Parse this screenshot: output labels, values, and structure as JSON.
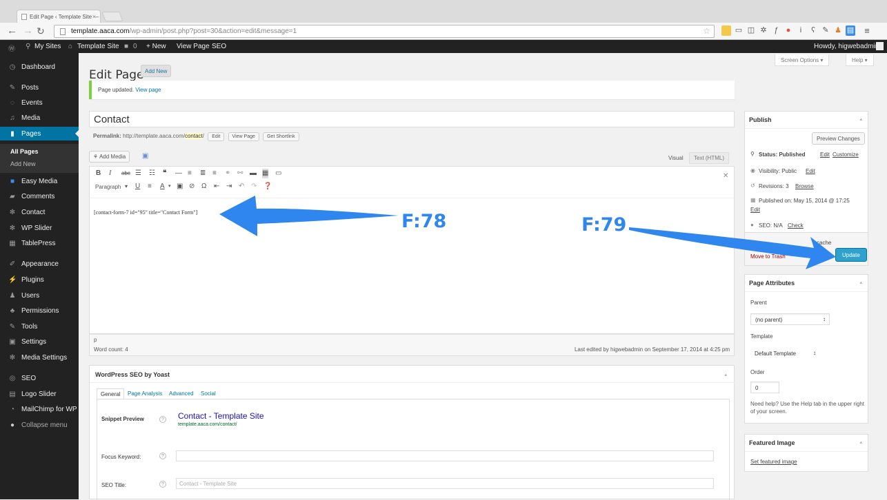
{
  "browser": {
    "tab_title": "Edit Page ‹ Template Site —",
    "tab_close": "×",
    "url_host": "template.aaca.com",
    "url_path": "/wp-admin/post.php?post=30&action=edit&message=1"
  },
  "adminbar": {
    "my_sites": "My Sites",
    "site_name": "Template Site",
    "comments_count": "0",
    "new_label": "+ New",
    "view_page": "View Page",
    "seo": "SEO",
    "howdy": "Howdy, higwebadmin"
  },
  "sidebar": {
    "items": [
      {
        "label": "Dashboard",
        "icon": "dashboard-icon"
      },
      {
        "label": "Posts",
        "icon": "pin-icon"
      },
      {
        "label": "Events",
        "icon": "events-icon"
      },
      {
        "label": "Media",
        "icon": "media-icon"
      },
      {
        "label": "Pages",
        "icon": "pages-icon"
      },
      {
        "label": "Easy Media",
        "icon": "easy-media-icon"
      },
      {
        "label": "Comments",
        "icon": "comments-icon"
      },
      {
        "label": "Contact",
        "icon": "gear-icon"
      },
      {
        "label": "WP Slider",
        "icon": "gear-icon"
      },
      {
        "label": "TablePress",
        "icon": "table-icon"
      },
      {
        "label": "Appearance",
        "icon": "brush-icon"
      },
      {
        "label": "Plugins",
        "icon": "plug-icon"
      },
      {
        "label": "Users",
        "icon": "users-icon"
      },
      {
        "label": "Permissions",
        "icon": "permissions-icon"
      },
      {
        "label": "Tools",
        "icon": "wrench-icon"
      },
      {
        "label": "Settings",
        "icon": "settings-icon"
      },
      {
        "label": "Media Settings",
        "icon": "gear-icon"
      },
      {
        "label": "SEO",
        "icon": "seo-icon"
      },
      {
        "label": "Logo Slider",
        "icon": "slider-icon"
      },
      {
        "label": "MailChimp for WP",
        "icon": "mailchimp-icon"
      },
      {
        "label": "Collapse menu",
        "icon": "collapse-icon"
      }
    ],
    "submenu": {
      "all_pages": "All Pages",
      "add_new": "Add New"
    }
  },
  "header": {
    "title": "Edit Page",
    "add_new": "Add New",
    "screen_options": "Screen Options ▾",
    "help": "Help ▾"
  },
  "notice": {
    "text": "Page updated.",
    "link": "View page"
  },
  "post": {
    "title": "Contact",
    "permalink_label": "Permalink:",
    "permalink_base": "http://template.aaca.com/",
    "permalink_slug": "contact",
    "permalink_end": "/",
    "edit_btn": "Edit",
    "view_page_btn": "View Page",
    "shortlink_btn": "Get Shortlink"
  },
  "editor": {
    "add_media": "Add Media",
    "tab_visual": "Visual",
    "tab_text": "Text (HTML)",
    "format_select": "Paragraph",
    "content": "[contact-form-7 id=\"95\" title=\"Contact Form\"]",
    "path": "p",
    "word_count": "Word count: 4",
    "last_edited": "Last edited by higwebadmin on September 17, 2014 at 4:25 pm"
  },
  "seo": {
    "title": "WordPress SEO by Yoast",
    "tabs": [
      "General",
      "Page Analysis",
      "Advanced",
      "Social"
    ],
    "snippet_label": "Snippet Preview",
    "snippet_title": "Contact - Template Site",
    "snippet_url": "template.aaca.com/contact/",
    "focus_label": "Focus Keyword:",
    "seo_title_label": "SEO Title:",
    "seo_title_placeholder": "Contact - Template Site"
  },
  "publish": {
    "title": "Publish",
    "preview_btn": "Preview Changes",
    "status_label": "Status: Published",
    "status_edit": "Edit",
    "status_customize": "Customize",
    "visibility_label": "Visibility: Public",
    "visibility_edit": "Edit",
    "revisions_label": "Revisions: 3",
    "revisions_browse": "Browse",
    "published_label": "Published on: May 15, 2014 @ 17:25",
    "published_edit": "Edit",
    "seo_label": "SEO: N/A",
    "seo_check": "Check",
    "cache_text": "cache",
    "trash": "Move to Trash",
    "update_btn": "Update"
  },
  "attributes": {
    "title": "Page Attributes",
    "parent_label": "Parent",
    "parent_value": "(no parent)",
    "template_label": "Template",
    "template_value": "Default Template",
    "order_label": "Order",
    "order_value": "0",
    "help_text": "Need help? Use the Help tab in the upper right of your screen."
  },
  "featured": {
    "title": "Featured Image",
    "link": "Set featured image"
  },
  "annotations": {
    "f78": "F:78",
    "f79": "F:79"
  },
  "colors": {
    "accent": "#0074a2",
    "primary_button": "#2ea2cc",
    "annotation": "#2f86ee",
    "adminbar": "#222222"
  }
}
